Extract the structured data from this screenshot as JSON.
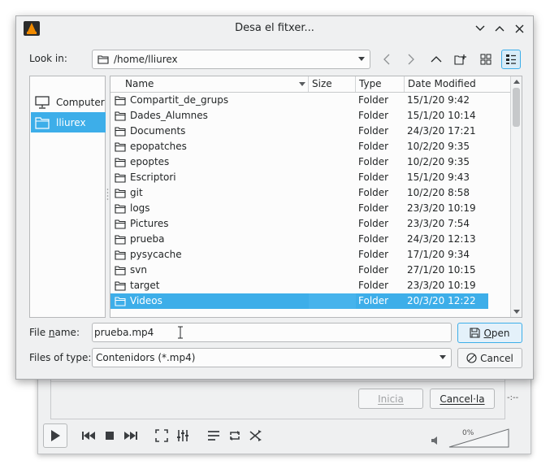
{
  "dialog": {
    "title": "Desa el fitxer...",
    "look_in_label": "Look in:",
    "look_in_path": "/home/lliurex",
    "file_name_label_pre": "File ",
    "file_name_label_u": "n",
    "file_name_label_post": "ame:",
    "file_name_value": "prueba.mp4",
    "files_of_type_label": "Files of type:",
    "files_of_type_value": "Contenidors (*.mp4)",
    "open_label_pre": "",
    "open_label_u": "O",
    "open_label_post": "pen",
    "cancel_label": "Cancel"
  },
  "sidebar": {
    "items": [
      {
        "label": "Computer",
        "icon": "monitor-icon"
      },
      {
        "label": "lliurex",
        "icon": "folder-icon"
      }
    ]
  },
  "columns": {
    "name": "Name",
    "size": "Size",
    "type": "Type",
    "date": "Date Modified"
  },
  "files": [
    {
      "name": "Compartit_de_grups",
      "type": "Folder",
      "date": "15/1/20 9:42"
    },
    {
      "name": "Dades_Alumnes",
      "type": "Folder",
      "date": "15/1/20 10:14"
    },
    {
      "name": "Documents",
      "type": "Folder",
      "date": "24/3/20 17:21"
    },
    {
      "name": "epopatches",
      "type": "Folder",
      "date": "10/2/20 9:35"
    },
    {
      "name": "epoptes",
      "type": "Folder",
      "date": "10/2/20 9:35"
    },
    {
      "name": "Escriptori",
      "type": "Folder",
      "date": "15/1/20 9:43"
    },
    {
      "name": "git",
      "type": "Folder",
      "date": "10/2/20 8:58"
    },
    {
      "name": "logs",
      "type": "Folder",
      "date": "23/3/20 10:19"
    },
    {
      "name": "Pictures",
      "type": "Folder",
      "date": "23/3/20 7:54"
    },
    {
      "name": "prueba",
      "type": "Folder",
      "date": "24/3/20 12:13"
    },
    {
      "name": "pysycache",
      "type": "Folder",
      "date": "17/1/20 9:34"
    },
    {
      "name": "svn",
      "type": "Folder",
      "date": "27/1/20 10:15"
    },
    {
      "name": "target",
      "type": "Folder",
      "date": "23/3/20 10:19"
    },
    {
      "name": "Videos",
      "type": "Folder",
      "date": "20/3/20 12:22"
    }
  ],
  "background": {
    "inicia_label": "Inicia",
    "cancella_label": "Cancel·la",
    "volume_pct": "0%",
    "dash": "-:--"
  },
  "colors": {
    "selection": "#3daee9",
    "window_bg": "#eff0f1"
  }
}
